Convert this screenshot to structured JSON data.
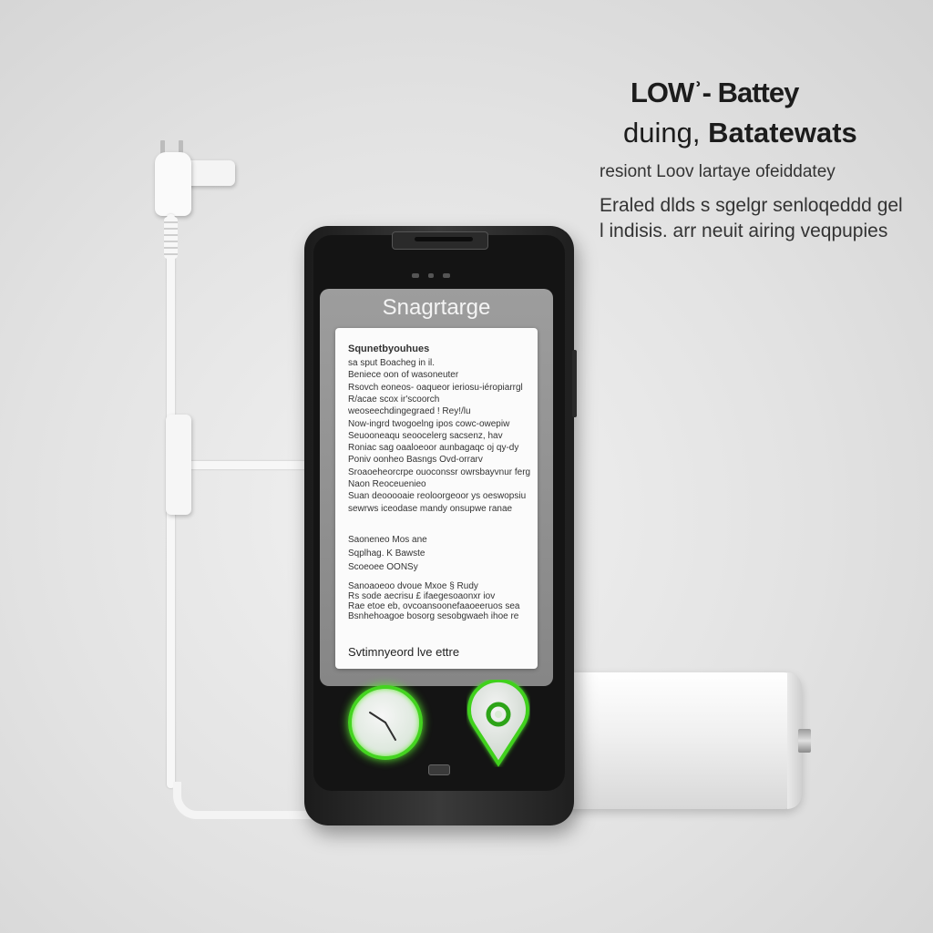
{
  "headlines": {
    "line1": "LOWʾ- Battey",
    "line2_prefix": "duing,",
    "line2_bold": "Batatewats",
    "line3": "resiont Loov lartaye ofeiddatey",
    "line4": "Eraled dlds s sgelgr senloqeddd gel",
    "line5": "l indisis. arr neuit airing veqpupies"
  },
  "phone": {
    "screen_title": "Snagrtarge",
    "card_heading": "Squnetbyouhues",
    "card_lines": [
      "sa sput Boacheg in il.",
      "Beniece oon of wasoneuter",
      "Rsovch eoneos- oaqueor ieriosu-iéropiarrgl",
      "R/acae scox ir'scoorch",
      "weoseechdingegraed ! Rey!/lu",
      "Now-ingrd twogoelng ipos cowc-owepiw",
      "Seuooneaqu seoocelerg sacsenz, hav",
      "Roniac sag oaaloeoor aunbagaqc oj qy-dy",
      "Poniv oonheo Basngs Ovd-orrarv",
      "Sroaoeheorcrpe ouoconssr owrsbayvnur fergn",
      "Naon Reoceuenieo",
      "Suan deooooaie reoloorgeoor ys oeswopsiu",
      "sewrws iceodase mandy onsupwe ranae"
    ],
    "card_mid": [
      "Saoneneo Mos ane",
      "Sqplhag. K Bawste",
      "Scoeoee OONSy"
    ],
    "card_lines2": [
      "Sanoaoeoo dvoue Mxoe § Rudy",
      "Rs sode aecrisu £ ifaegesoaonxr iov",
      "Rae etoe eb, ovcoansoonefaaoeeruos sea",
      "Bsnhehoagoe bosorg sesobgwaeh ihoe re"
    ],
    "card_footer": "Svtimnyeord lve ettre"
  },
  "colors": {
    "glow_green": "#44d420",
    "phone_body": "#1f1f1f",
    "background": "#e2e2e2"
  },
  "icons": [
    "clock-icon",
    "location-pin-icon"
  ]
}
